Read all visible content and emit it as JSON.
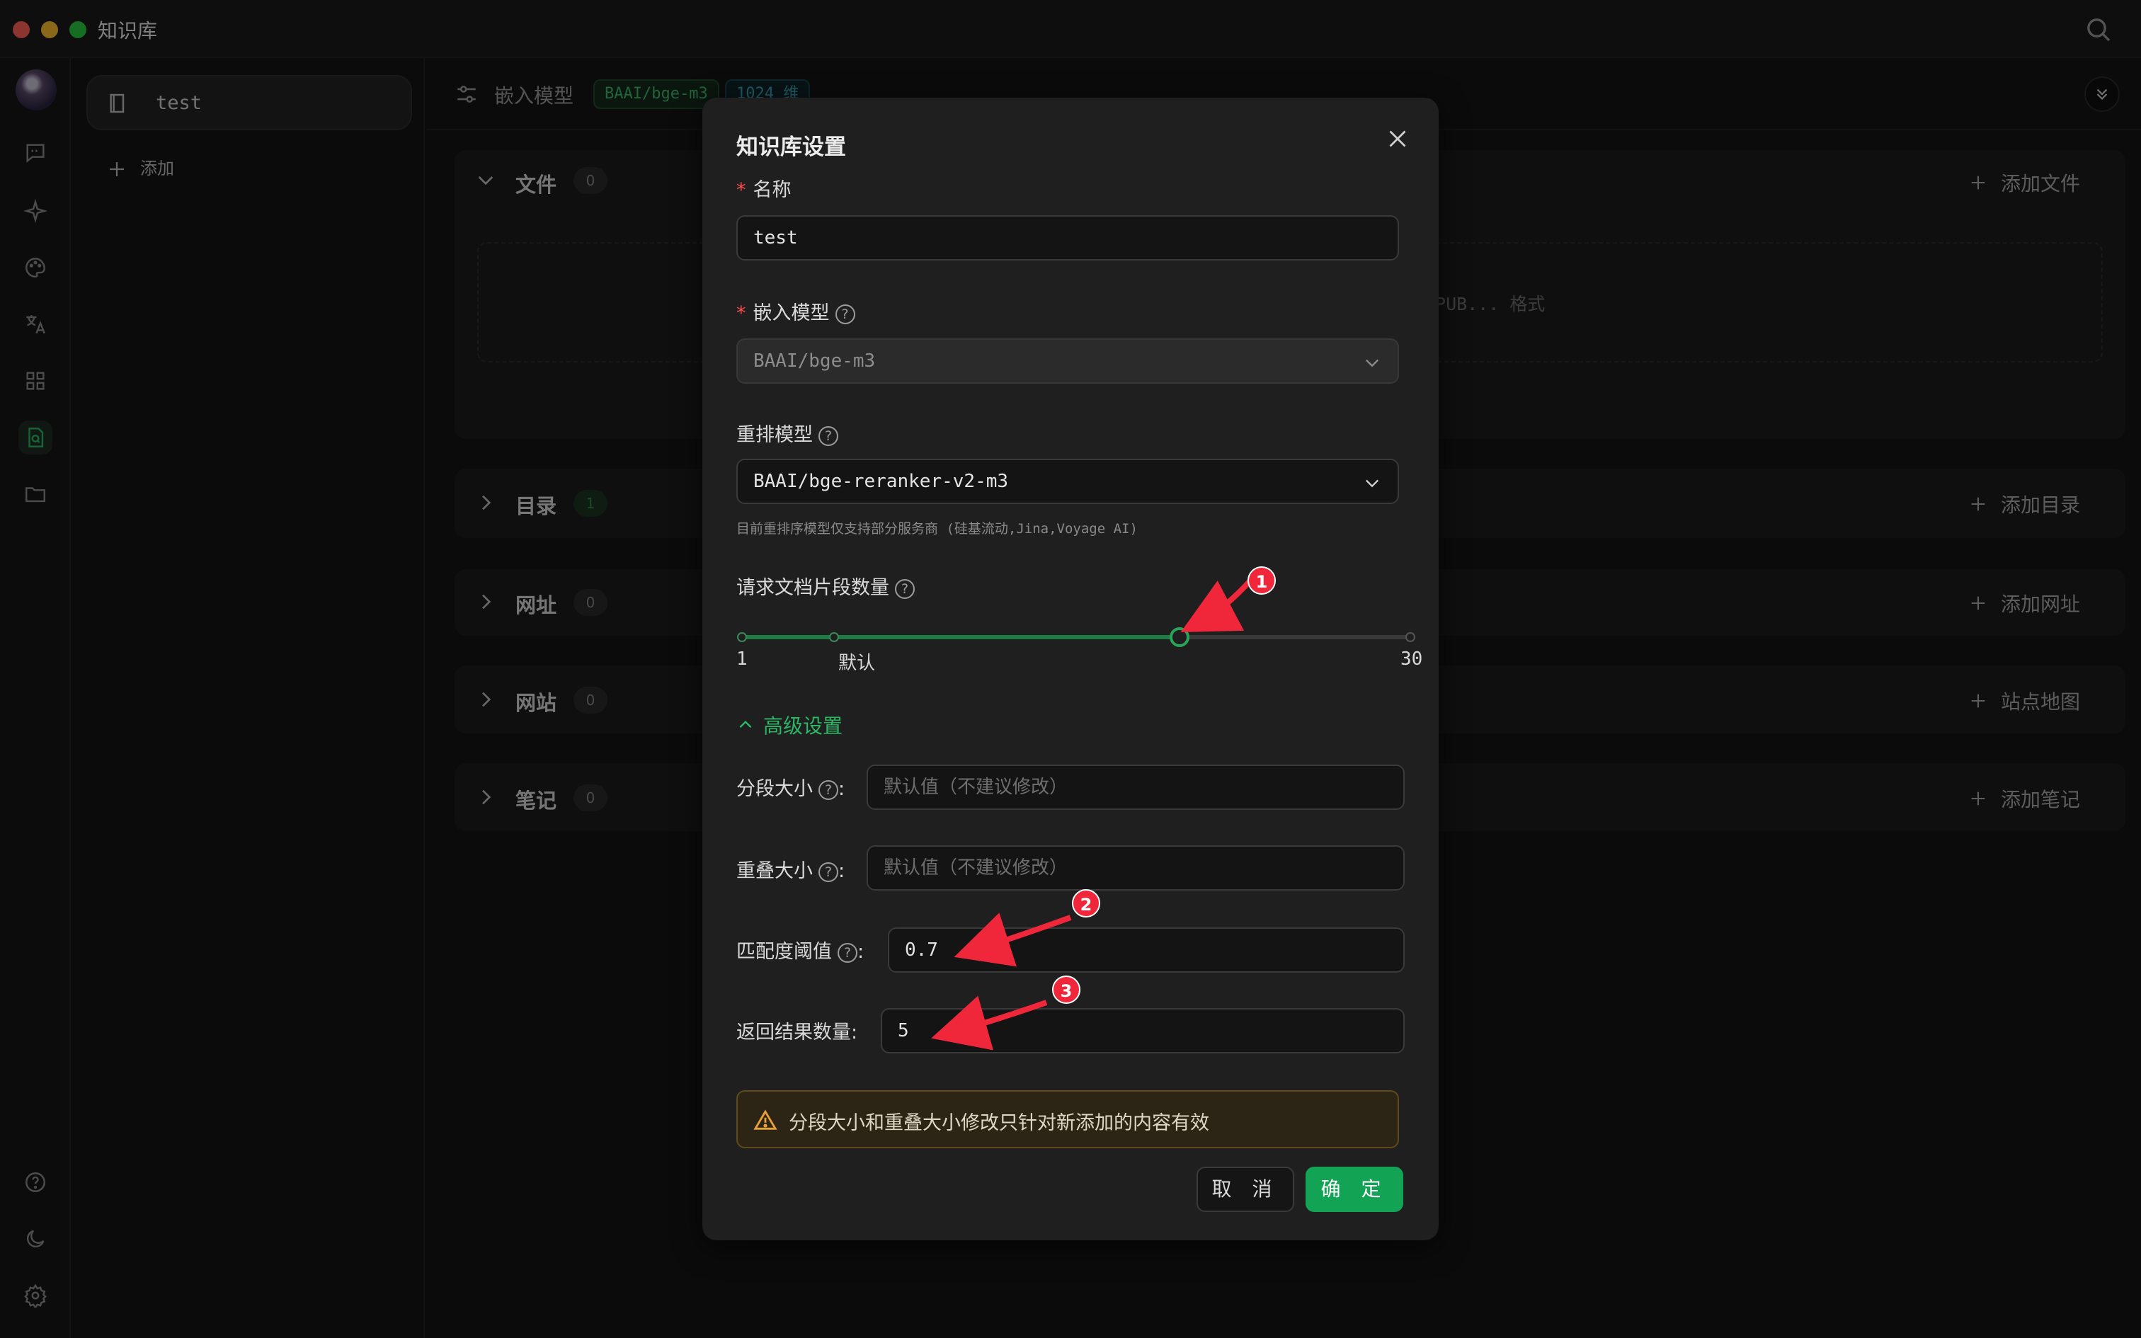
{
  "window": {
    "title": "知识库"
  },
  "kb_list": {
    "items": [
      {
        "label": "test"
      }
    ],
    "add_label": "添加"
  },
  "main": {
    "embed_label": "嵌入模型",
    "embed_model_tag": "BAAI/bge-m3",
    "dimension_tag": "1024 维",
    "sections": [
      {
        "title": "文件",
        "count": "0",
        "action": "添加文件",
        "expanded": true,
        "drop_hint": "EPUB... 格式"
      },
      {
        "title": "目录",
        "count": "1",
        "action": "添加目录",
        "expanded": false
      },
      {
        "title": "网址",
        "count": "0",
        "action": "添加网址",
        "expanded": false
      },
      {
        "title": "网站",
        "count": "0",
        "action": "站点地图",
        "expanded": false
      },
      {
        "title": "笔记",
        "count": "0",
        "action": "添加笔记",
        "expanded": false
      }
    ]
  },
  "modal": {
    "title": "知识库设置",
    "name_label": "名称",
    "name_value": "test",
    "embed_label": "嵌入模型",
    "embed_value": "BAAI/bge-m3",
    "rerank_label": "重排模型",
    "rerank_value": "BAAI/bge-reranker-v2-m3",
    "rerank_hint": "目前重排序模型仅支持部分服务商 (硅基流动,Jina,Voyage AI)",
    "count_label": "请求文档片段数量",
    "slider": {
      "min": 1,
      "max": 30,
      "default": 5,
      "value": 20,
      "min_label": "1",
      "default_label": "默认",
      "max_label": "30"
    },
    "advanced_label": "高级设置",
    "chunk_size_label": "分段大小",
    "chunk_size_placeholder": "默认值（不建议修改）",
    "overlap_label": "重叠大小",
    "overlap_placeholder": "默认值（不建议修改）",
    "threshold_label": "匹配度阈值",
    "threshold_value": "0.7",
    "topk_label": "返回结果数量",
    "topk_value": "5",
    "warning": "分段大小和重叠大小修改只针对新添加的内容有效",
    "cancel_label": "取 消",
    "ok_label": "确 定"
  },
  "annotations": [
    "1",
    "2",
    "3"
  ],
  "colors": {
    "accent": "#12a454",
    "annotation": "#f0273a"
  }
}
